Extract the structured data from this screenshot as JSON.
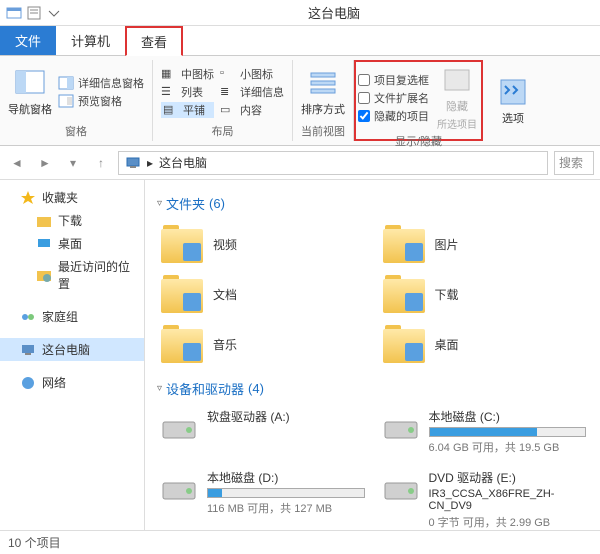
{
  "window": {
    "title": "这台电脑"
  },
  "tabs": {
    "file": "文件",
    "computer": "计算机",
    "view": "查看"
  },
  "ribbon": {
    "panes": {
      "nav": "导航窗格",
      "details_pane": "详细信息窗格",
      "preview_pane": "预览窗格",
      "title": "窗格"
    },
    "layout": {
      "medium_icons": "中图标",
      "small_icons": "小图标",
      "list": "列表",
      "details": "详细信息",
      "tiles": "平铺",
      "content": "内容",
      "title": "布局"
    },
    "current_view": {
      "sort": "排序方式",
      "title": "当前视图"
    },
    "show_hide": {
      "checkboxes": "项目复选框",
      "extensions": "文件扩展名",
      "hidden_items": "隐藏的项目",
      "hide": "隐藏",
      "selected": "所选项目",
      "title": "显示/隐藏"
    },
    "options": "选项"
  },
  "breadcrumb": {
    "root_icon_title": "此电脑",
    "location": "这台电脑"
  },
  "search": {
    "placeholder": "搜索"
  },
  "tree": {
    "favorites": "收藏夹",
    "downloads": "下载",
    "desktop": "桌面",
    "recent": "最近访问的位置",
    "homegroup": "家庭组",
    "this_pc": "这台电脑",
    "network": "网络"
  },
  "sections": {
    "folders": {
      "title": "文件夹",
      "count": "(6)"
    },
    "drives": {
      "title": "设备和驱动器",
      "count": "(4)"
    }
  },
  "folders": [
    {
      "name": "视频"
    },
    {
      "name": "图片"
    },
    {
      "name": "文档"
    },
    {
      "name": "下载"
    },
    {
      "name": "音乐"
    },
    {
      "name": "桌面"
    }
  ],
  "drives": [
    {
      "name": "软盘驱动器 (A:)",
      "bar": false,
      "fill": 0,
      "stats": ""
    },
    {
      "name": "本地磁盘 (C:)",
      "bar": true,
      "fill": 69,
      "stats": "6.04 GB 可用，共 19.5 GB"
    },
    {
      "name": "本地磁盘 (D:)",
      "bar": true,
      "fill": 9,
      "stats": "116 MB 可用，共 127 MB"
    },
    {
      "name": "DVD 驱动器 (E:)",
      "sub": "IR3_CCSA_X86FRE_ZH-CN_DV9",
      "bar": false,
      "fill": 0,
      "stats": "0 字节 可用，共 2.99 GB"
    }
  ],
  "status": {
    "items": "10 个项目"
  }
}
